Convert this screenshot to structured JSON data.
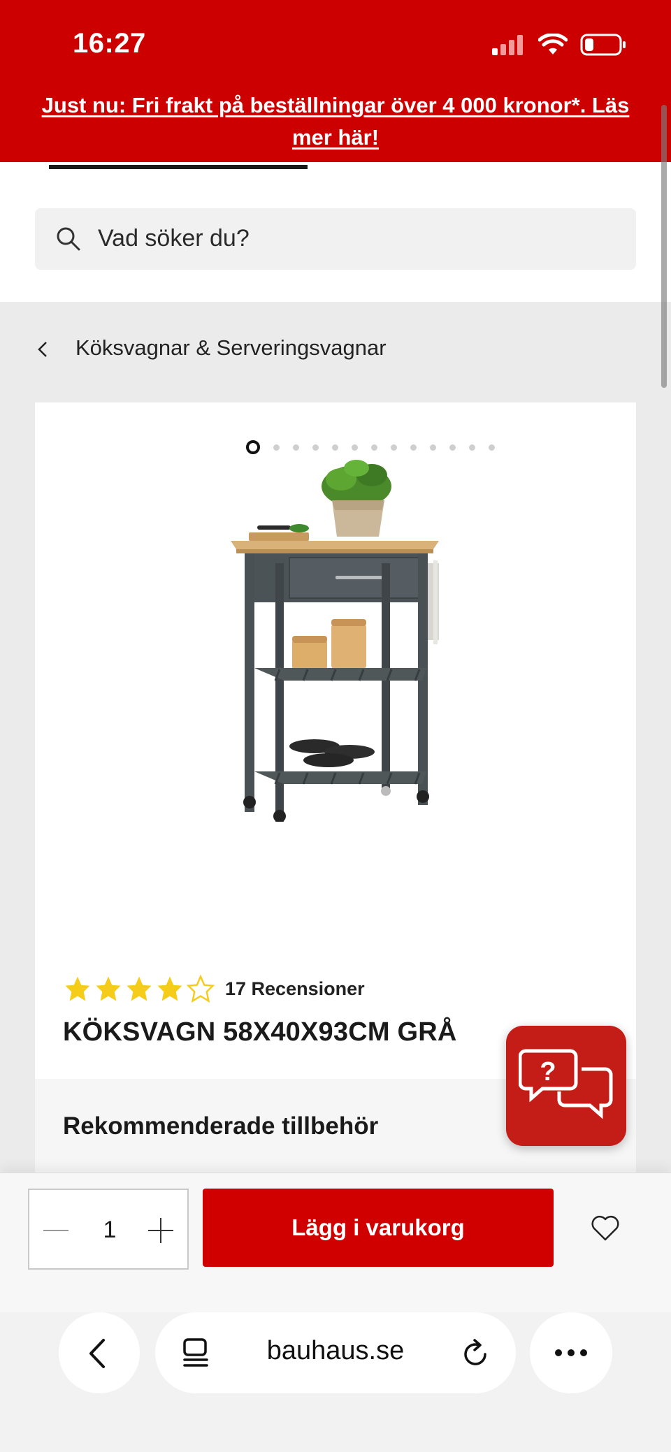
{
  "status_bar": {
    "time": "16:27",
    "icons": [
      "signal-icon",
      "wifi-icon",
      "battery-icon"
    ]
  },
  "promo": {
    "text": "Just nu: Fri frakt på beställningar över 4 000 kronor*. Läs mer här!"
  },
  "search": {
    "placeholder": "Vad söker du?",
    "icon": "search-icon"
  },
  "breadcrumb": {
    "label": "Köksvagnar & Serveringsvagnar",
    "icon": "chevron-left-icon"
  },
  "gallery": {
    "total_images": 13,
    "active_index": 0
  },
  "product": {
    "rating": 4,
    "rating_max": 5,
    "reviews_label": "17 Recensioner",
    "title": "KÖKSVAGN 58X40X93CM GRÅ"
  },
  "recommended": {
    "title": "Rekommenderade tillbehör"
  },
  "action_bar": {
    "quantity": "1",
    "add_to_cart_label": "Lägg i varukorg"
  },
  "browser": {
    "url": "bauhaus.se"
  },
  "colors": {
    "brand_red": "#cd0000",
    "button_red": "#d10000",
    "star_yellow": "#f6cc1b"
  }
}
